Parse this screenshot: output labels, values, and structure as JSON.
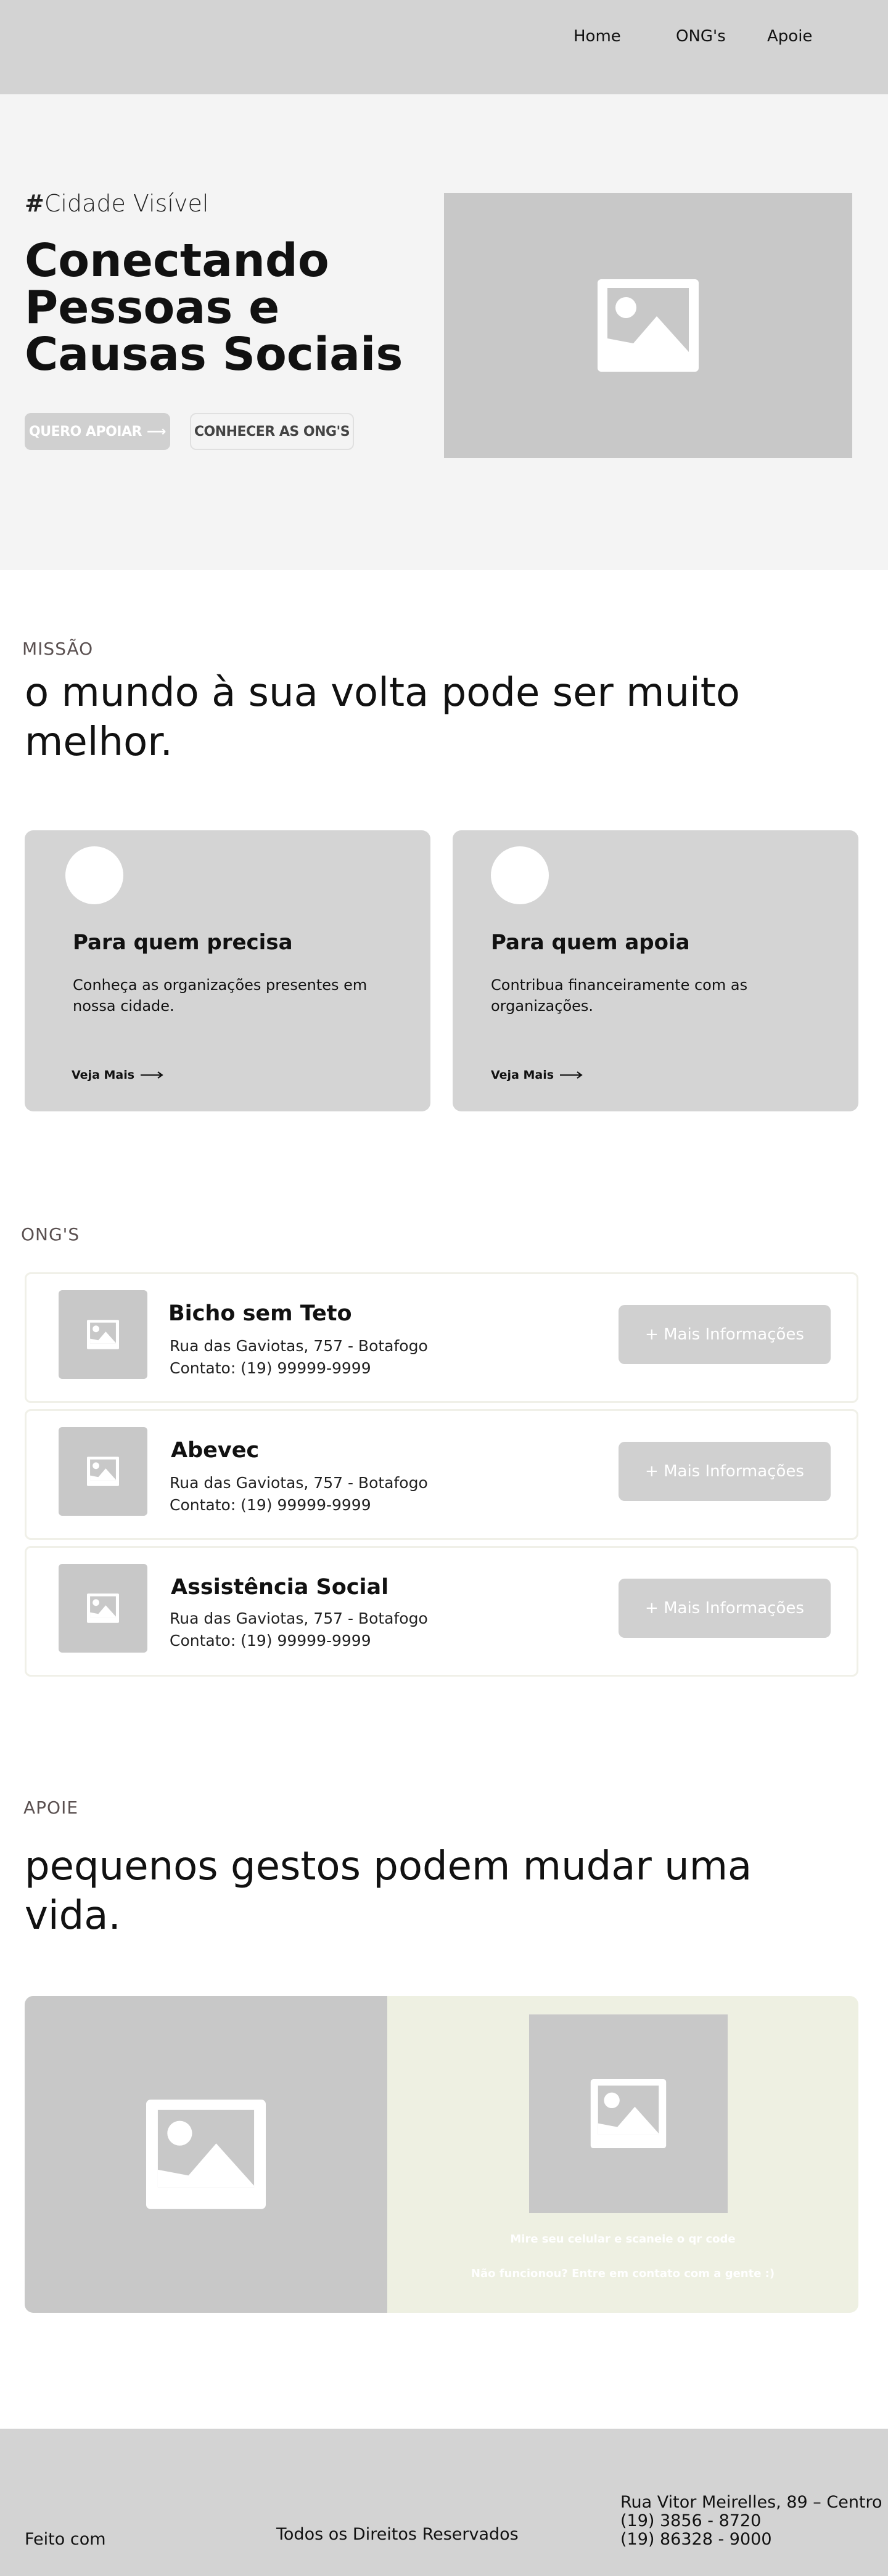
{
  "nav": {
    "links": [
      "Home",
      "ONG's",
      "Apoie"
    ]
  },
  "hero": {
    "tag_hash": "#",
    "tag_text": "Cidade Visível",
    "title": "Conectando Pessoas e Causas Sociais",
    "btn_apoiar": "QUERO APOIAR",
    "btn_apoiar_arrow": "⟶",
    "btn_ongs": "CONHECER AS ONG'S"
  },
  "missao": {
    "label": "MISSÃO",
    "heading": "o mundo à sua volta pode ser muito melhor.",
    "cards": [
      {
        "title": "Para quem precisa",
        "text": "Conheça as organizações presentes em nossa cidade.",
        "link": "Veja Mais"
      },
      {
        "title": "Para quem apoia",
        "text": "Contribua financeiramente com as organizações.",
        "link": "Veja Mais"
      }
    ]
  },
  "ongs": {
    "label": "ONG'S",
    "items": [
      {
        "name": "Bicho sem Teto",
        "address": "Rua das Gaviotas, 757 - Botafogo",
        "contact": "Contato: (19) 99999-9999",
        "button": "+ Mais Informações"
      },
      {
        "name": "Abevec",
        "address": "Rua das Gaviotas, 757 - Botafogo",
        "contact": "Contato: (19) 99999-9999",
        "button": "+ Mais Informações"
      },
      {
        "name": "Assistência Social",
        "address": "Rua das Gaviotas, 757  - Botafogo",
        "contact": "Contato: (19) 99999-9999",
        "button": "+ Mais Informações"
      }
    ]
  },
  "apoie": {
    "label": "APOIE",
    "heading": "pequenos gestos podem mudar uma vida.",
    "qr_text": "Mire seu celular e scaneie o qr code",
    "fallback_text": "Não funcionou? Entre em contato com a gente :)"
  },
  "footer": {
    "made_with": "Feito com",
    "rights": "Todos os Direitos Reservados",
    "address": "Rua Vitor Meirelles, 89 – Centro",
    "phone1": "(19) 3856 - 8720",
    "phone2": "(19) 86328 - 9000"
  },
  "icons": {
    "image_placeholder": "image-placeholder-icon",
    "arrow": "arrow-right-icon"
  },
  "colors": {
    "nav_bg": "#d3d3d3",
    "hero_bg": "#f4f4f4",
    "placeholder": "#c8c8c8",
    "card_bg": "#d4d4d4",
    "apoie_right_bg": "#eef0e2"
  }
}
